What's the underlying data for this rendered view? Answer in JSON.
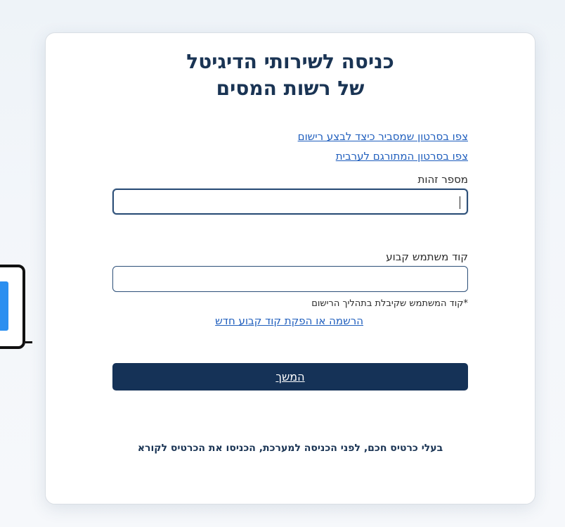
{
  "header": {
    "title_line1": "כניסה לשירותי הדיגיטל",
    "title_line2": "של רשות המסים"
  },
  "links": {
    "video_registration": "צפו בסרטון שמסביר כיצד לבצע רישום",
    "video_arabic": "צפו בסרטון המתורגם לערבית"
  },
  "form": {
    "id_label": "מספר זהות",
    "id_value": "",
    "code_label": "קוד משתמש קבוע",
    "code_value": "",
    "code_note": "*קוד המשתמש שקיבלת בתהליך הרישום",
    "register_link": "הרשמה או הפקת קוד קבוע חדש",
    "continue_label": "המשך"
  },
  "footer": {
    "smartcard_note": "בעלי כרטיס חכם, לפני הכניסה למערכת, הכניסו את הכרטיס לקורא"
  },
  "colors": {
    "primary": "#153257",
    "link": "#1f5ebd",
    "title": "#1a3454"
  }
}
